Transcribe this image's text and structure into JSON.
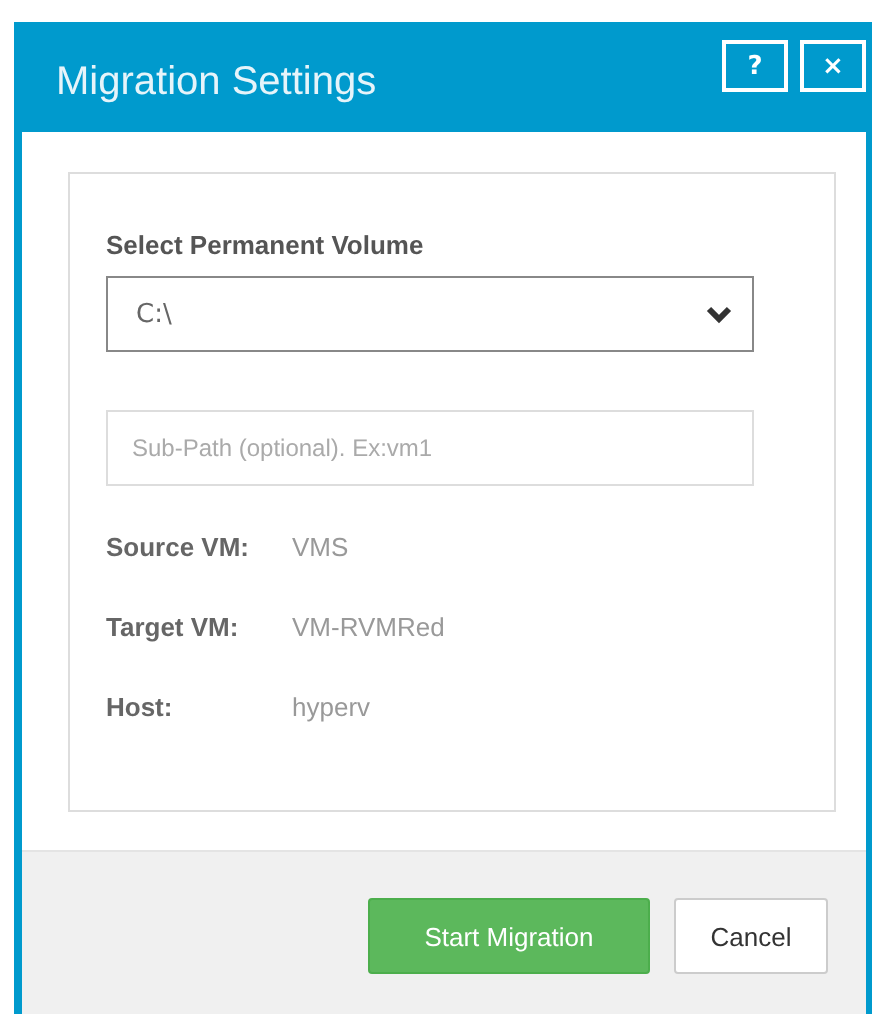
{
  "window": {
    "title": "Migration Settings",
    "buttons": [
      "?",
      "×"
    ]
  },
  "volume": {
    "label": "Select Permanent Volume",
    "value": "C:\\"
  },
  "sub_path": {
    "placeholder": "Sub-Path (optional). Ex:vm1"
  },
  "details": [
    {
      "label": "Source VM:",
      "value": "VMS"
    },
    {
      "label": "Target VM:",
      "value": "VM-RVMRed"
    },
    {
      "label": "Host:",
      "value": "hyperv"
    }
  ],
  "buttons": [
    {
      "kind": "primary",
      "label": "Start Migration"
    },
    {
      "kind": "secondary",
      "label": "Cancel"
    }
  ]
}
